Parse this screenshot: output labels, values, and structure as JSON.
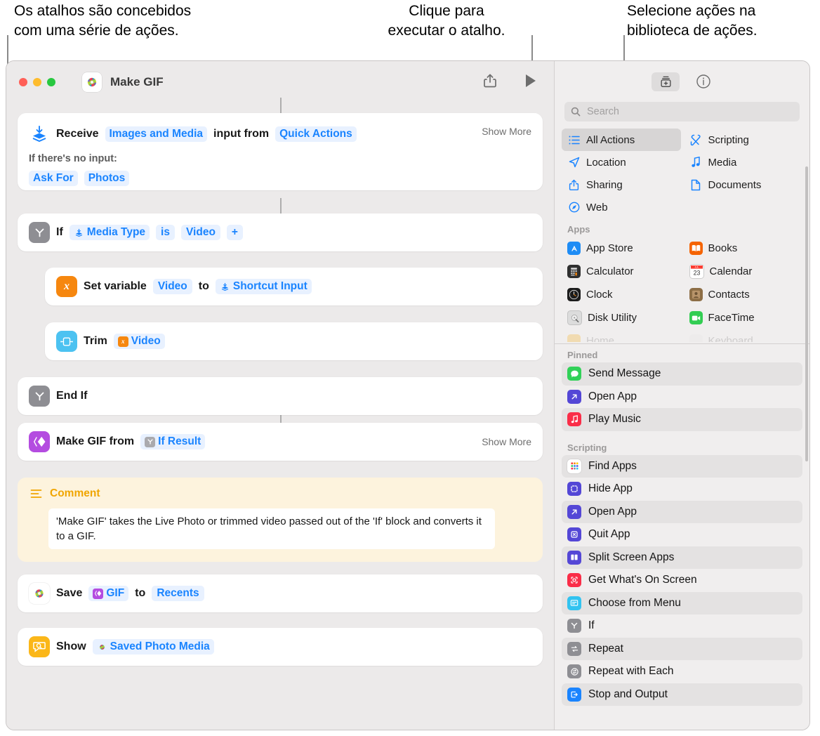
{
  "annotations": [
    {
      "id": "callout-left",
      "text": "Os atalhos são concebidos\ncom uma série de ações."
    },
    {
      "id": "callout-mid",
      "text": "Clique para\nexecutar o atalho."
    },
    {
      "id": "callout-right",
      "text": "Selecione ações na\nbiblioteca de ações."
    }
  ],
  "window": {
    "title": "Make GIF",
    "app_icon": "photos-icon",
    "share_button": "share-icon",
    "run_button": "play-icon"
  },
  "flow": {
    "receive": {
      "icon": "receive-input-icon",
      "prefix": "Receive",
      "input_type": "Images and Media",
      "middle": "input from",
      "source": "Quick Actions",
      "show_more": "Show More",
      "no_input_label": "If there's no input:",
      "no_input_action": "Ask For",
      "no_input_target": "Photos"
    },
    "if": {
      "icon": "if-icon",
      "prefix": "If",
      "variable": "Media Type",
      "operator": "is",
      "value": "Video",
      "add": "+"
    },
    "set_variable": {
      "icon": "variable-icon",
      "prefix": "Set variable",
      "name": "Video",
      "middle": "to",
      "value": "Shortcut Input"
    },
    "trim": {
      "icon": "trim-icon",
      "prefix": "Trim",
      "value": "Video"
    },
    "end_if": {
      "icon": "if-icon",
      "label": "End If"
    },
    "make_gif": {
      "icon": "make-gif-icon",
      "prefix": "Make GIF from",
      "value": "If Result",
      "show_more": "Show More"
    },
    "comment": {
      "icon": "comment-lines-icon",
      "title": "Comment",
      "body": "'Make GIF' takes the Live Photo or trimmed video passed out of the 'If' block and converts it to a GIF."
    },
    "save": {
      "icon": "photos-icon",
      "prefix": "Save",
      "value": "GIF",
      "middle": "to",
      "destination": "Recents"
    },
    "show": {
      "icon": "quick-look-icon",
      "prefix": "Show",
      "value": "Saved Photo Media"
    }
  },
  "library": {
    "toolbar": {
      "add_action_button": "add-action-icon",
      "info_button": "info-icon"
    },
    "search": {
      "placeholder": "Search",
      "value": "",
      "icon": "search-icon"
    },
    "categories": [
      {
        "label": "All Actions",
        "icon": "list-icon",
        "selected": true
      },
      {
        "label": "Scripting",
        "icon": "scripting-icon",
        "selected": false
      },
      {
        "label": "Location",
        "icon": "location-icon",
        "selected": false
      },
      {
        "label": "Media",
        "icon": "music-note-icon",
        "selected": false
      },
      {
        "label": "Sharing",
        "icon": "share-icon",
        "selected": false
      },
      {
        "label": "Documents",
        "icon": "document-icon",
        "selected": false
      },
      {
        "label": "Web",
        "icon": "safari-icon",
        "selected": false
      }
    ],
    "apps_section": {
      "title": "Apps",
      "items": [
        {
          "label": "App Store",
          "icon": "app-store-icon",
          "color": "#1e8cf5"
        },
        {
          "label": "Books",
          "icon": "books-icon",
          "color": "#f56300"
        },
        {
          "label": "Calculator",
          "icon": "calculator-icon",
          "color": "#3a3a3a"
        },
        {
          "label": "Calendar",
          "icon": "calendar-icon",
          "color": "#ffffff"
        },
        {
          "label": "Clock",
          "icon": "clock-icon",
          "color": "#1c1c1c"
        },
        {
          "label": "Contacts",
          "icon": "contacts-icon",
          "color": "#9a7b4f"
        },
        {
          "label": "Disk Utility",
          "icon": "disk-utility-icon",
          "color": "#d9d9d9"
        },
        {
          "label": "FaceTime",
          "icon": "facetime-icon",
          "color": "#32cd52"
        }
      ]
    },
    "pinned_section": {
      "title": "Pinned",
      "items": [
        {
          "label": "Send Message",
          "icon": "messages-icon",
          "color": "#31d158"
        },
        {
          "label": "Open App",
          "icon": "open-app-icon",
          "color": "#5447d6"
        },
        {
          "label": "Play Music",
          "icon": "music-icon",
          "color": "#fa2d48"
        }
      ]
    },
    "scripting_section": {
      "title": "Scripting",
      "items": [
        {
          "label": "Find Apps",
          "icon": "find-apps-icon",
          "color": "#ffffff"
        },
        {
          "label": "Hide App",
          "icon": "hide-app-icon",
          "color": "#5447d6"
        },
        {
          "label": "Open App",
          "icon": "open-app-icon",
          "color": "#5447d6"
        },
        {
          "label": "Quit App",
          "icon": "quit-app-icon",
          "color": "#5447d6"
        },
        {
          "label": "Split Screen Apps",
          "icon": "split-screen-icon",
          "color": "#5447d6"
        },
        {
          "label": "Get What's On Screen",
          "icon": "screen-capture-icon",
          "color": "#fa2d48"
        },
        {
          "label": "Choose from Menu",
          "icon": "menu-icon",
          "color": "#32c3f0"
        },
        {
          "label": "If",
          "icon": "if-icon",
          "color": "#8e8e93"
        },
        {
          "label": "Repeat",
          "icon": "repeat-icon",
          "color": "#8e8e93"
        },
        {
          "label": "Repeat with Each",
          "icon": "repeat-each-icon",
          "color": "#8e8e93"
        },
        {
          "label": "Stop and Output",
          "icon": "stop-output-icon",
          "color": "#1a84ff"
        }
      ]
    }
  },
  "colors": {
    "accent_blue": "#1a84ff",
    "token_bg": "#e8f1ff",
    "comment_bg": "#fdf3dd",
    "comment_accent": "#f0a500",
    "window_bg": "#eceaea",
    "library_bg": "#f0eeee"
  }
}
